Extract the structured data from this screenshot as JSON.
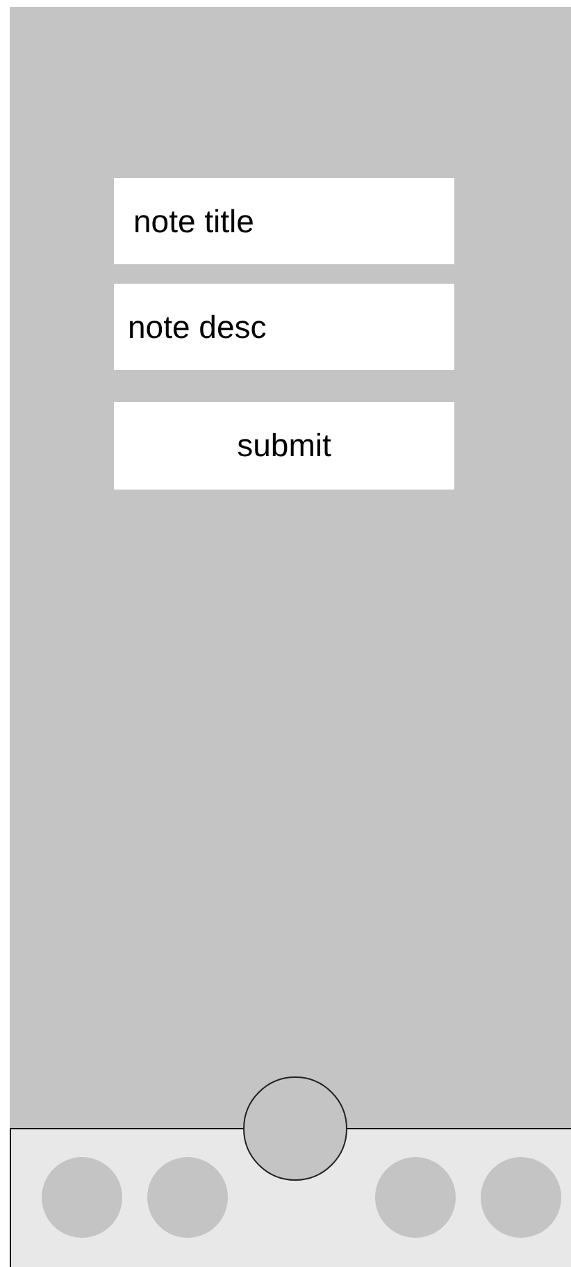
{
  "form": {
    "fields": [
      {
        "value": "note title"
      },
      {
        "value": "note desc"
      }
    ],
    "submit_button": {
      "label": "submit"
    }
  }
}
